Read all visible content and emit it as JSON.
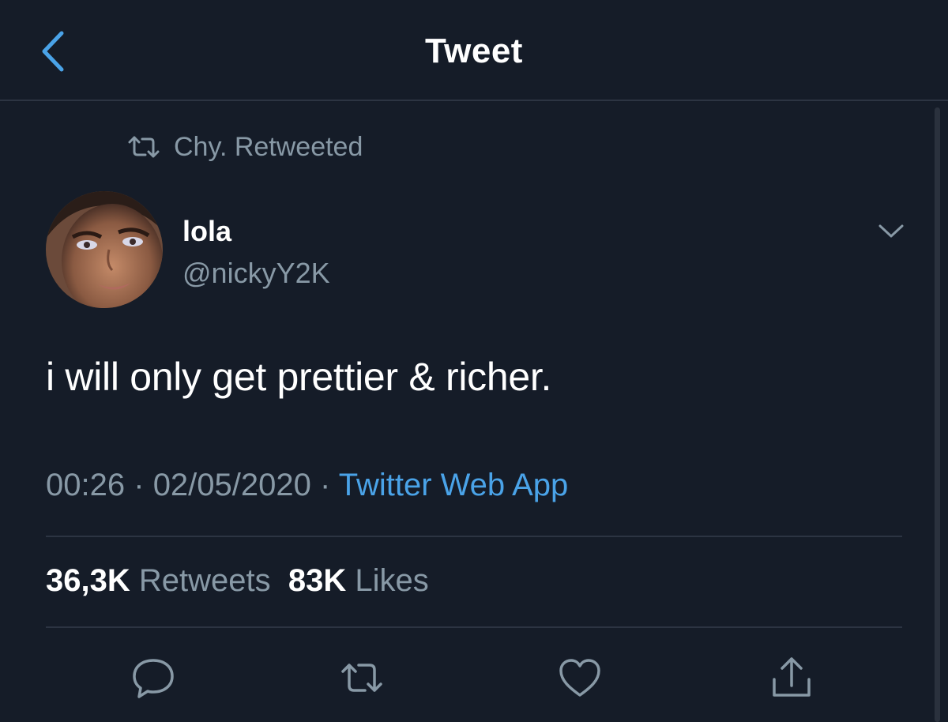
{
  "header": {
    "title": "Tweet"
  },
  "retweet_context": {
    "label": "Chy. Retweeted"
  },
  "author": {
    "display_name": "lola",
    "handle": "@nickyY2K"
  },
  "tweet": {
    "text": "i will only get prettier & richer.",
    "time": "00:26",
    "date": "02/05/2020",
    "separator": "·",
    "source": "Twitter Web App"
  },
  "stats": {
    "retweets_count": "36,3K",
    "retweets_label": "Retweets",
    "likes_count": "83K",
    "likes_label": "Likes"
  },
  "colors": {
    "background": "#151c28",
    "accent": "#4aa3e8",
    "secondary_text": "#8899a6",
    "divider": "#2c3442"
  },
  "icons": {
    "back": "chevron-left-icon",
    "retweet_context": "retweet-icon",
    "menu": "chevron-down-icon",
    "reply": "reply-icon",
    "retweet": "retweet-icon",
    "like": "heart-icon",
    "share": "share-icon"
  }
}
